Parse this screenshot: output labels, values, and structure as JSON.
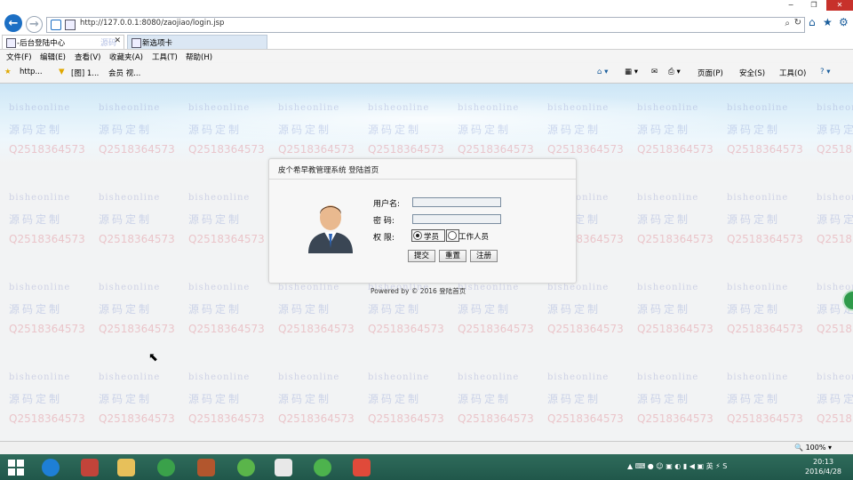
{
  "window": {
    "min_label": "−",
    "max_label": "❐",
    "close_label": "✕"
  },
  "address_bar": {
    "url": "http://127.0.0.1:8080/zaojiao/login.jsp",
    "search_icon": "search-icon",
    "refresh_icon": "refresh-icon"
  },
  "tabs": [
    {
      "label": "-后台登陆中心",
      "active": true
    },
    {
      "label": "新选项卡",
      "active": false
    }
  ],
  "tab_partial_label": "源码",
  "menu": [
    "文件(F)",
    "编辑(E)",
    "查看(V)",
    "收藏夹(A)",
    "工具(T)",
    "帮助(H)"
  ],
  "favorites": [
    "http...",
    "[图] 1...",
    "会员 视..."
  ],
  "command_bar": [
    "页面(P)",
    "安全(S)",
    "工具(O)"
  ],
  "page": {
    "login_title": "皮个希早教管理系统 登陆首页",
    "username_label": "用户名:",
    "username_value": "",
    "password_label": "密  码:",
    "password_value": "",
    "role_label": "权  限:",
    "role_options": [
      "学员",
      "工作人员"
    ],
    "role_selected": "学员",
    "buttons": {
      "submit": "提交",
      "reset": "重置",
      "register": "注册"
    },
    "footer": "Powered by © 2016  登陆首页"
  },
  "watermark": {
    "line1": "bisheonline",
    "line2": "源码定制",
    "line3": "Q2518364573"
  },
  "status_bar": {
    "zoom": "100%"
  },
  "taskbar": {
    "time": "20:13",
    "date": "2016/4/28",
    "tray_lang": "英"
  },
  "colors": {
    "taskbar": "#2a6252",
    "close_button": "#c7312b",
    "banner": "#cde6f6"
  }
}
